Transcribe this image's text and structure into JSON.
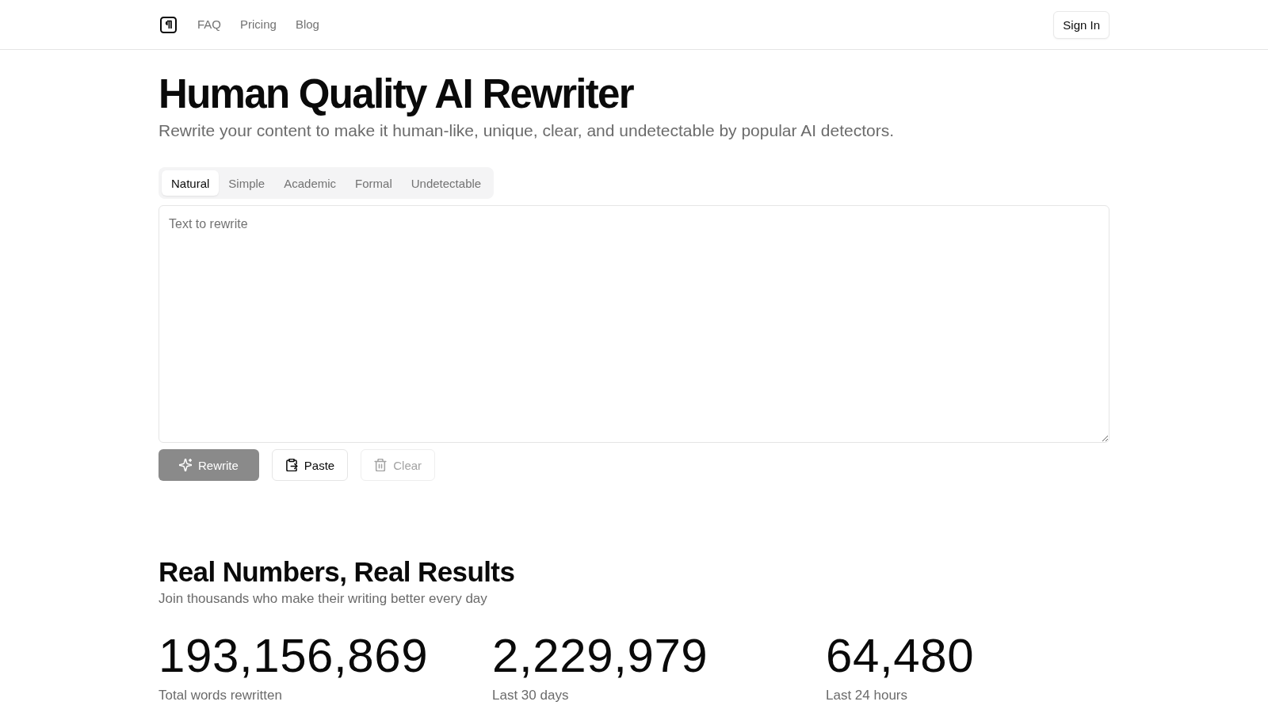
{
  "header": {
    "links": [
      "FAQ",
      "Pricing",
      "Blog"
    ],
    "sign_in": "Sign In"
  },
  "hero": {
    "title": "Human Quality AI Rewriter",
    "subtitle": "Rewrite your content to make it human-like, unique, clear, and undetectable by popular AI detectors."
  },
  "tabs": [
    {
      "label": "Natural",
      "selected": true
    },
    {
      "label": "Simple",
      "selected": false
    },
    {
      "label": "Academic",
      "selected": false
    },
    {
      "label": "Formal",
      "selected": false
    },
    {
      "label": "Undetectable",
      "selected": false
    }
  ],
  "editor": {
    "placeholder": "Text to rewrite"
  },
  "buttons": [
    {
      "kind": "primary",
      "label": "Rewrite",
      "disabled": true
    },
    {
      "kind": "outline",
      "label": "Paste",
      "disabled": false
    },
    {
      "kind": "outline",
      "label": "Clear",
      "disabled": true
    }
  ],
  "stats": {
    "title": "Real Numbers, Real Results",
    "subtitle": "Join thousands who make their writing better every day",
    "items": [
      {
        "value": "193,156,869",
        "label": "Total words rewritten"
      },
      {
        "value": "2,229,979",
        "label": "Last 30 days"
      },
      {
        "value": "64,480",
        "label": "Last 24 hours"
      }
    ]
  }
}
